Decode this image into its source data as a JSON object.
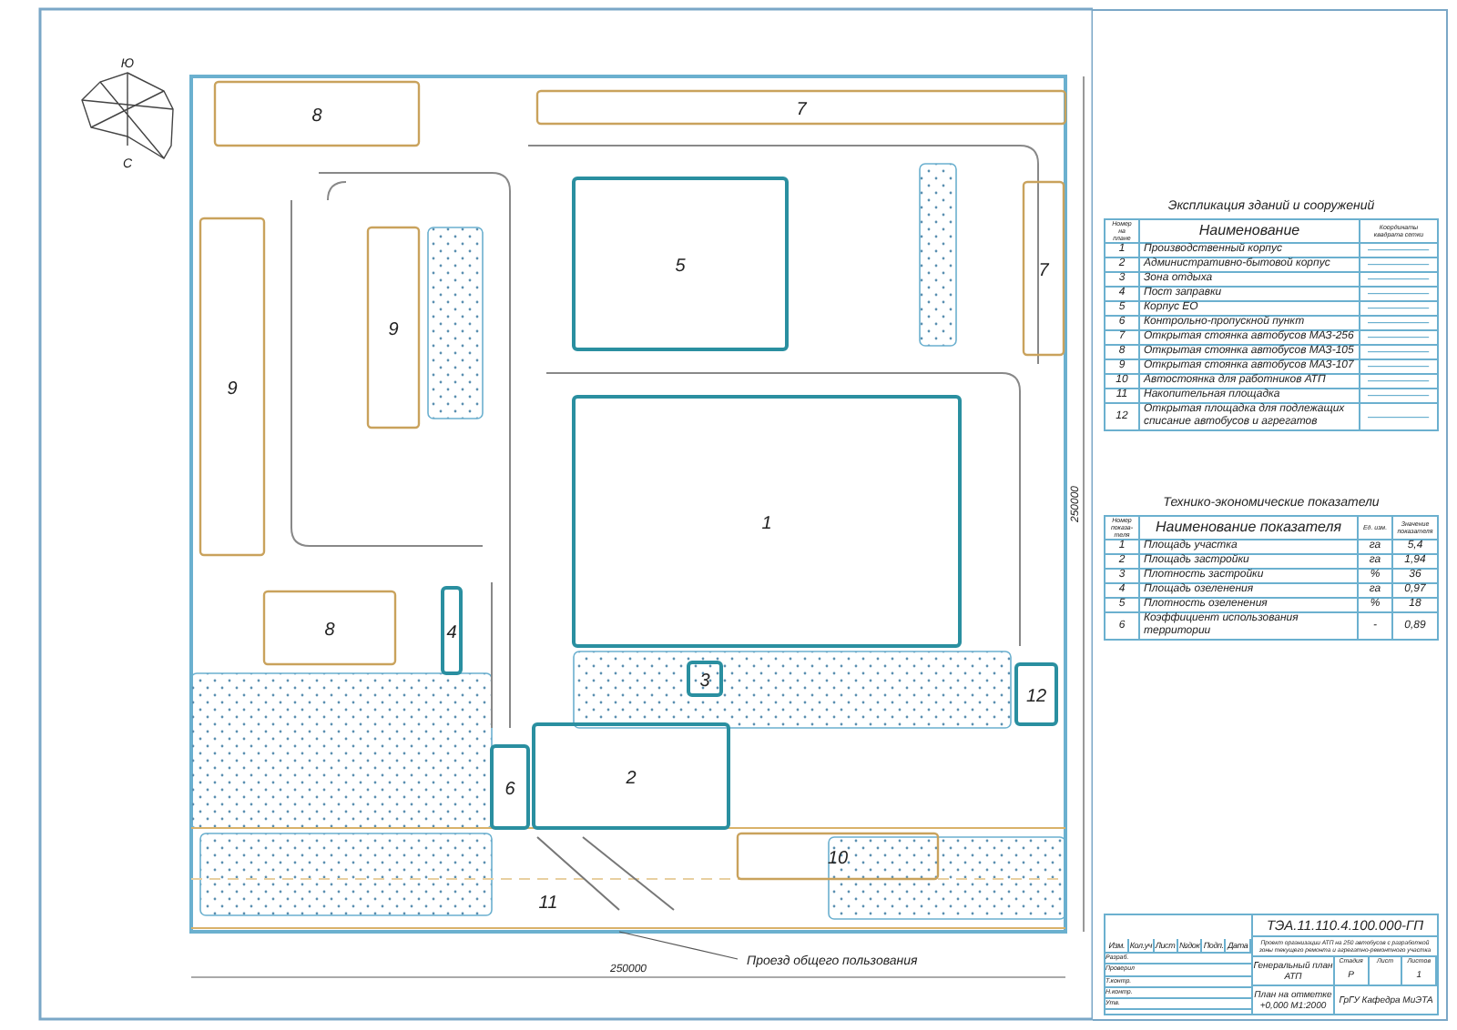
{
  "compass": {
    "top": "Ю",
    "bottom": "С"
  },
  "plan": {
    "objects": [
      {
        "label": "7",
        "kind": "parking"
      },
      {
        "label": "8",
        "kind": "parking"
      },
      {
        "label": "5",
        "kind": "building"
      },
      {
        "label": "7",
        "kind": "parking"
      },
      {
        "label": "9",
        "kind": "parking"
      },
      {
        "label": "9",
        "kind": "parking"
      },
      {
        "label": "1",
        "kind": "building"
      },
      {
        "label": "8",
        "kind": "parking"
      },
      {
        "label": "4",
        "kind": "building"
      },
      {
        "label": "3",
        "kind": "building"
      },
      {
        "label": "12",
        "kind": "building"
      },
      {
        "label": "6",
        "kind": "building"
      },
      {
        "label": "2",
        "kind": "building"
      },
      {
        "label": "10",
        "kind": "parking"
      },
      {
        "label": "11",
        "kind": "area"
      }
    ],
    "road_label": "Проезд общего пользования",
    "width_dimension": "250000",
    "height_dimension": "250000"
  },
  "explication": {
    "title": "Экспликация зданий и сооружений",
    "columns": [
      "Номер на плане",
      "Наименование",
      "Координаты квадрата сетки"
    ],
    "rows": [
      {
        "number": "1",
        "name": "Производственный корпус"
      },
      {
        "number": "2",
        "name": "Административно-бытовой корпус"
      },
      {
        "number": "3",
        "name": "Зона отдыха"
      },
      {
        "number": "4",
        "name": "Пост заправки"
      },
      {
        "number": "5",
        "name": "Корпус ЕО"
      },
      {
        "number": "6",
        "name": "Контрольно-пропускной пункт"
      },
      {
        "number": "7",
        "name": "Открытая стоянка автобусов МАЗ-256"
      },
      {
        "number": "8",
        "name": "Открытая стоянка автобусов МАЗ-105"
      },
      {
        "number": "9",
        "name": "Открытая стоянка автобусов МАЗ-107"
      },
      {
        "number": "10",
        "name": "Автостоянка для работников АТП"
      },
      {
        "number": "11",
        "name": "Накопительная площадка"
      },
      {
        "number": "12",
        "name": "Открытая площадка для подлежащих списание автобусов и агрегатов"
      }
    ]
  },
  "indicators": {
    "title": "Технико-экономические показатели",
    "columns": [
      "Номер показа- теля",
      "Наименование показателя",
      "Ед. изм.",
      "Значение показателя"
    ],
    "rows": [
      {
        "number": "1",
        "name": "Площадь участка",
        "unit": "га",
        "value": "5,4"
      },
      {
        "number": "2",
        "name": "Площадь застройки",
        "unit": "га",
        "value": "1,94"
      },
      {
        "number": "3",
        "name": "Плотность застройки",
        "unit": "%",
        "value": "36"
      },
      {
        "number": "4",
        "name": "Площадь озеленения",
        "unit": "га",
        "value": "0,97"
      },
      {
        "number": "5",
        "name": "Плотность озеленения",
        "unit": "%",
        "value": "18"
      },
      {
        "number": "6",
        "name": "Коэффициент использования территории",
        "unit": "-",
        "value": "0,89"
      }
    ]
  },
  "title_block": {
    "code": "ТЭА.11.110.4.100.000-ГП",
    "project": "Проект организации АТП на 250 автобусов с разработкой зоны текущего ремонта и агрегатно-ремонтного участка",
    "sheet_title": "Генеральный план АТП",
    "plan_title": "План на отметке +0,000 М1:2000",
    "stage_label": "Стадия",
    "sheet_label": "Лист",
    "sheets_label": "Листов",
    "stage": "Р",
    "sheets": "1",
    "organization": "ГрГУ Кафедра МиЭТА",
    "header_labels": [
      "Изм.",
      "Кол.уч",
      "Лист",
      "№док",
      "Подп.",
      "Дата"
    ],
    "role_labels": [
      "Разраб.",
      "Проверил",
      "Т.контр.",
      "Н.контр.",
      "Утв."
    ]
  }
}
